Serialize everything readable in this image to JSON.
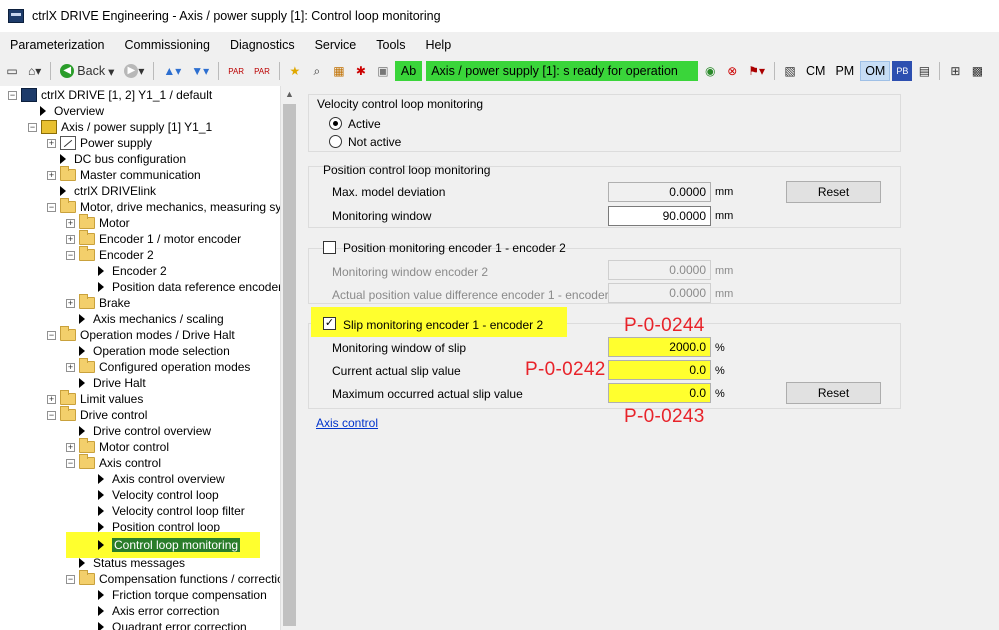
{
  "window": {
    "title": "ctrlX DRIVE Engineering - Axis / power supply [1]: Control loop monitoring"
  },
  "menu": [
    "Parameterization",
    "Commissioning",
    "Diagnostics",
    "Service",
    "Tools",
    "Help"
  ],
  "toolbar": {
    "back_label": "Back",
    "status_ab": "Ab",
    "status_text": "Axis / power supply [1]:  s ready for operation",
    "mode_cm": "CM",
    "mode_pm": "PM",
    "mode_om": "OM",
    "status_color": "#3ad53a",
    "active_mode": "OM"
  },
  "tree": {
    "root": "ctrlX DRIVE [1, 2] Y1_1 / default",
    "overview": "Overview",
    "axis": "Axis / power supply [1] Y1_1",
    "power_supply": "Power supply",
    "dc_bus": "DC bus configuration",
    "master_comm": "Master communication",
    "drivelink": "ctrlX DRIVElink",
    "motor_mech": "Motor, drive mechanics, measuring syster",
    "motor": "Motor",
    "encoder1": "Encoder 1 / motor encoder",
    "encoder2": "Encoder 2",
    "encoder2_sub": "Encoder 2",
    "pos_ref": "Position data reference encoder :",
    "brake": "Brake",
    "axis_mech": "Axis mechanics / scaling",
    "op_modes": "Operation modes / Drive Halt",
    "op_mode_sel": "Operation mode selection",
    "configured_op": "Configured operation modes",
    "drive_halt": "Drive Halt",
    "limit_values": "Limit values",
    "drive_control": "Drive control",
    "drive_control_overview": "Drive control overview",
    "motor_control": "Motor control",
    "axis_control": "Axis control",
    "axis_control_overview": "Axis control overview",
    "velocity_loop": "Velocity control loop",
    "velocity_filter": "Velocity control loop filter",
    "position_loop": "Position control loop",
    "control_loop_monitoring": "Control loop monitoring",
    "status_messages": "Status messages",
    "compensation": "Compensation functions / corrections",
    "friction": "Friction torque compensation",
    "axis_error": "Axis error correction",
    "quadrant": "Quadrant error correction"
  },
  "velocity_group": {
    "title": "Velocity control loop monitoring",
    "active": "Active",
    "not_active": "Not active",
    "selected": "Active"
  },
  "position_group": {
    "title": "Position control loop monitoring",
    "max_dev_label": "Max. model deviation",
    "max_dev_value": "0.0000",
    "max_dev_unit": "mm",
    "window_label": "Monitoring window",
    "window_value": "90.0000",
    "window_unit": "mm",
    "reset": "Reset"
  },
  "enc_group": {
    "title": "Position monitoring encoder 1 - encoder 2",
    "checked": false,
    "window_label": "Monitoring window encoder 2",
    "window_value": "0.0000",
    "window_unit": "mm",
    "diff_label": "Actual position value difference encoder 1 - encoder 2",
    "diff_value": "0.0000",
    "diff_unit": "mm"
  },
  "slip_group": {
    "title": "Slip monitoring encoder 1 - encoder 2",
    "checked": true,
    "window_label": "Monitoring window of slip",
    "window_value": "2000.0",
    "window_unit": "%",
    "current_label": "Current actual slip value",
    "current_value": "0.0",
    "current_unit": "%",
    "max_label": "Maximum occurred actual slip value",
    "max_value": "0.0",
    "max_unit": "%",
    "reset": "Reset"
  },
  "annotations": {
    "p244": "P-0-0244",
    "p242": "P-0-0242",
    "p243": "P-0-0243",
    "color": "#e8232a",
    "highlight": "#ffff2e"
  },
  "link": {
    "axis_control": "Axis control"
  }
}
